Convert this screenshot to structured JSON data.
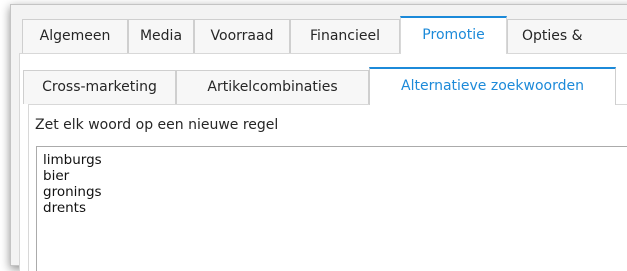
{
  "main_tabs": [
    {
      "label": "Algemeen"
    },
    {
      "label": "Media"
    },
    {
      "label": "Voorraad"
    },
    {
      "label": "Financieel"
    },
    {
      "label": "Promotie"
    },
    {
      "label": "Opties &"
    }
  ],
  "active_main_tab": "Promotie",
  "sub_tabs": [
    {
      "label": "Cross-marketing"
    },
    {
      "label": "Artikelcombinaties"
    },
    {
      "label": "Alternatieve zoekwoorden"
    }
  ],
  "active_sub_tab": "Alternatieve zoekwoorden",
  "instruction": "Zet elk woord op een nieuwe regel",
  "keywords_value": "limburgs\nbier\ngronings\ndrents",
  "colors": {
    "accent": "#1c8ad9",
    "tab_background": "#f7f7f7",
    "border": "#cfcfcf"
  }
}
